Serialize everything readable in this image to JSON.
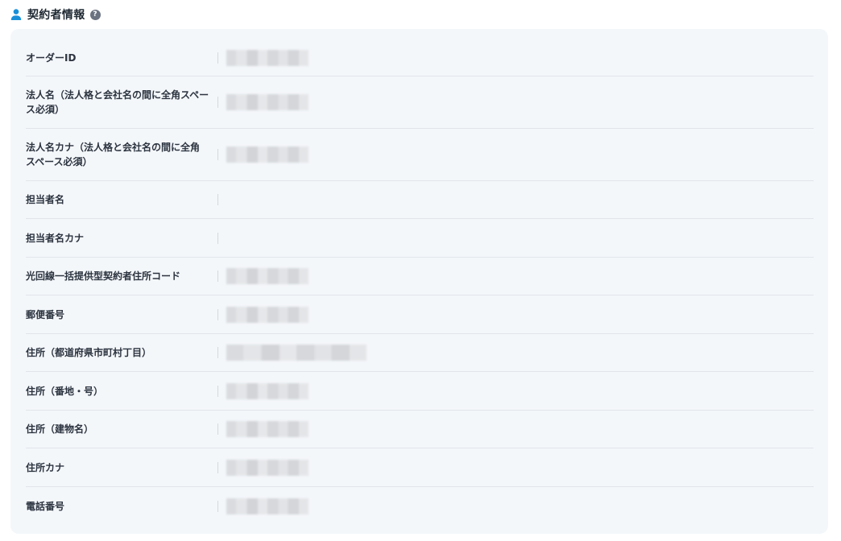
{
  "section": {
    "title": "契約者情報",
    "help_icon": "?"
  },
  "rows": [
    {
      "label": "オーダーID",
      "masked": true
    },
    {
      "label": "法人名（法人格と会社名の間に全角スペース必須）",
      "masked": true
    },
    {
      "label": "法人名カナ（法人格と会社名の間に全角スペース必須）",
      "masked": true
    },
    {
      "label": "担当者名",
      "masked": false
    },
    {
      "label": "担当者名カナ",
      "masked": false
    },
    {
      "label": "光回線一括提供型契約者住所コード",
      "masked": true
    },
    {
      "label": "郵便番号",
      "masked": true
    },
    {
      "label": "住所（都道府県市町村丁目）",
      "masked": true
    },
    {
      "label": "住所（番地・号）",
      "masked": true
    },
    {
      "label": "住所（建物名）",
      "masked": true
    },
    {
      "label": "住所カナ",
      "masked": true
    },
    {
      "label": "電話番号",
      "masked": true
    }
  ],
  "colors": {
    "accent": "#1a8fd8",
    "panel_bg": "#f4f7fa"
  }
}
